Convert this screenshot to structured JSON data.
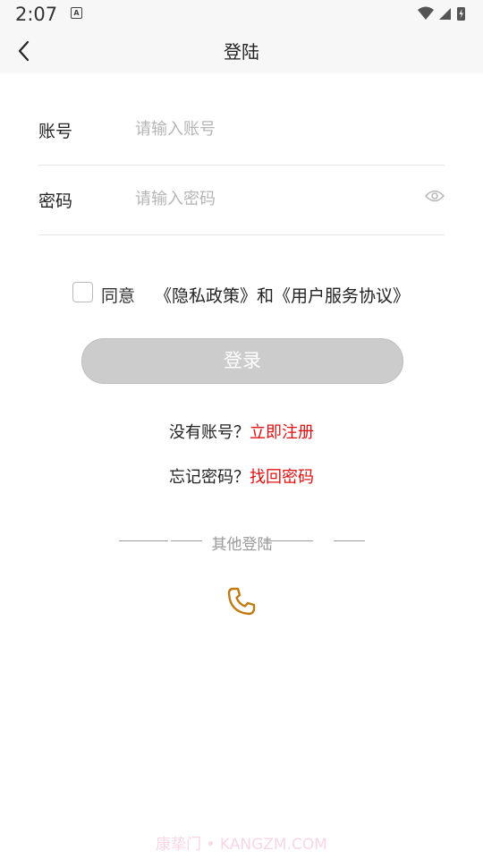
{
  "status_bar": {
    "time": "2:07",
    "notif_icon": "A"
  },
  "header": {
    "title": "登陆",
    "back_icon": "chevron-left-icon"
  },
  "form": {
    "account": {
      "label": "账号",
      "placeholder": "请输入账号",
      "value": ""
    },
    "password": {
      "label": "密码",
      "placeholder": "请输入密码",
      "value": "",
      "toggle_icon": "eye-icon"
    }
  },
  "agreement": {
    "checked": false,
    "text": "同意",
    "privacy": "《隐私政策》",
    "and": "和",
    "terms": "《用户服务协议》"
  },
  "login_button": {
    "label": "登录"
  },
  "register": {
    "prompt": "没有账号？",
    "link": "立即注册"
  },
  "forgot": {
    "prompt": "忘记密码？",
    "link": "找回密码"
  },
  "other_login": {
    "label": "其他登陆",
    "phone_icon": "phone-icon"
  },
  "watermark": "康挚门 • KANGZM.COM",
  "colors": {
    "accent_red": "#e01010",
    "phone_icon": "#c07a10",
    "button_disabled": "#cccccc"
  }
}
